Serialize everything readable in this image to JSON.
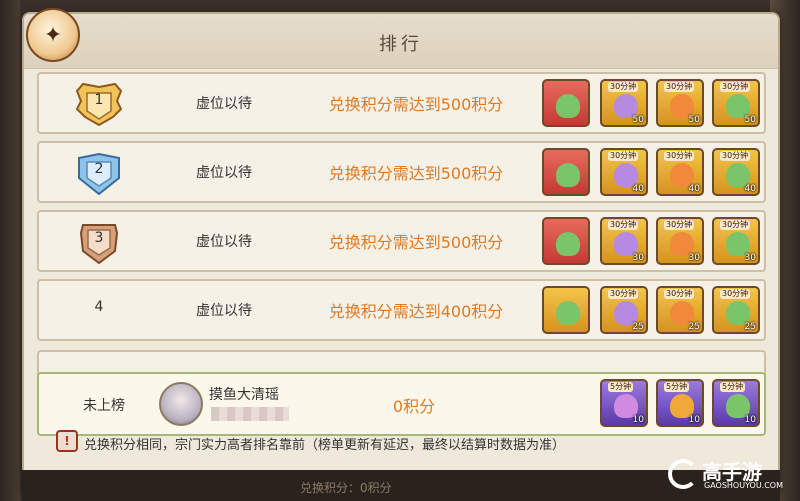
{
  "title": "排行",
  "rows": [
    {
      "rank": "1",
      "name": "虚位以待",
      "requirement": "兑换积分需达到500积分",
      "badge": "gold",
      "rewards": [
        {
          "style": "red",
          "tag": "",
          "qty": ""
        },
        {
          "style": "purple-gold",
          "tag": "30分钟",
          "qty": "50"
        },
        {
          "style": "gold",
          "tag": "30分钟",
          "qty": "50"
        },
        {
          "style": "green-gold",
          "tag": "30分钟",
          "qty": "50"
        }
      ]
    },
    {
      "rank": "2",
      "name": "虚位以待",
      "requirement": "兑换积分需达到500积分",
      "badge": "blue",
      "rewards": [
        {
          "style": "red",
          "tag": "",
          "qty": ""
        },
        {
          "style": "purple-gold",
          "tag": "30分钟",
          "qty": "40"
        },
        {
          "style": "gold",
          "tag": "30分钟",
          "qty": "40"
        },
        {
          "style": "green-gold",
          "tag": "30分钟",
          "qty": "40"
        }
      ]
    },
    {
      "rank": "3",
      "name": "虚位以待",
      "requirement": "兑换积分需达到500积分",
      "badge": "bronze",
      "rewards": [
        {
          "style": "red",
          "tag": "",
          "qty": ""
        },
        {
          "style": "purple-gold",
          "tag": "30分钟",
          "qty": "30"
        },
        {
          "style": "gold",
          "tag": "30分钟",
          "qty": "30"
        },
        {
          "style": "green-gold",
          "tag": "30分钟",
          "qty": "30"
        }
      ]
    },
    {
      "rank": "4",
      "name": "虚位以待",
      "requirement": "兑换积分需达到400积分",
      "badge": "none",
      "rewards": [
        {
          "style": "gold",
          "tag": "",
          "qty": ""
        },
        {
          "style": "purple-gold",
          "tag": "30分钟",
          "qty": "25"
        },
        {
          "style": "gold",
          "tag": "30分钟",
          "qty": "25"
        },
        {
          "style": "green-gold",
          "tag": "30分钟",
          "qty": "25"
        }
      ]
    }
  ],
  "self": {
    "rank_label": "未上榜",
    "name": "摸鱼大清瑶",
    "score": "0积分",
    "rewards": [
      {
        "style": "purple",
        "tag": "5分钟",
        "qty": "10"
      },
      {
        "style": "purple",
        "tag": "5分钟",
        "qty": "10"
      },
      {
        "style": "purple",
        "tag": "5分钟",
        "qty": "10"
      }
    ]
  },
  "footer_note": "兑换积分相同，宗门实力高者排名靠前（榜单更新有延迟，最终以结算时数据为准）",
  "bottom_text": "兑换积分：0积分",
  "logo": {
    "main": "高手游",
    "sub": "GAOSHOUYOU.COM"
  },
  "colors": {
    "accent": "#e07a22",
    "panel": "#efe9dc",
    "row": "#f6f1e7",
    "self_border": "#a7b779"
  }
}
